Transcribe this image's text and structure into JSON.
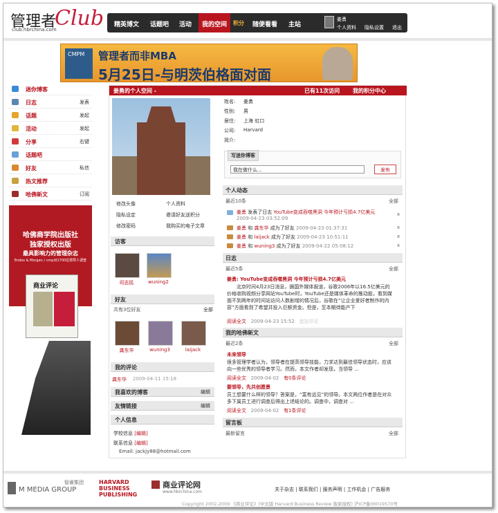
{
  "header": {
    "logo_cn": "管理者",
    "logo_club": "Club",
    "logo_url": "club.hbrchina.com",
    "nav": [
      "精英博文",
      "话题吧",
      "活动",
      "我的空间",
      "积分",
      "随便看看",
      "主站"
    ],
    "user_name": "姜勇",
    "user_links": [
      "个人资料",
      "隐私设置",
      "退出"
    ]
  },
  "banner": {
    "cmpm": "CMPM",
    "line1": "管理者而非MBA",
    "line2": "5月25日-与明茨伯格面对面"
  },
  "sidebar": {
    "items": [
      {
        "label": "迷你博客",
        "action": "",
        "color": "#3a8bd6"
      },
      {
        "label": "日志",
        "action": "发表",
        "color": "#5b86b3"
      },
      {
        "label": "话题",
        "action": "发起",
        "color": "#e5a52d"
      },
      {
        "label": "活动",
        "action": "发起",
        "color": "#e2b53c"
      },
      {
        "label": "分享",
        "action": "右键",
        "color": "#cf3a3a"
      },
      {
        "label": "话题吧",
        "action": "",
        "color": "#6aa0d8"
      },
      {
        "label": "好友",
        "action": "私信",
        "color": "#d88a2f"
      },
      {
        "label": "热文推荐",
        "action": "",
        "color": "#c6a144"
      },
      {
        "label": "哈佛新文",
        "action": "订阅",
        "color": "#9b2d2d"
      }
    ],
    "ad": {
      "l1": "哈佛商学院出版社",
      "l2": "独家授权出版",
      "l3": "最具影响力的管理杂志",
      "l4": "Endos & Morgan / cmp对1700位领导人调查",
      "book": "商业评论"
    }
  },
  "main": {
    "title": "姜勇的个人空间 -",
    "visits": "已有11次访问",
    "points_link": "我的积分中心",
    "actions": [
      "修改头像",
      "个人资料",
      "隐私设定",
      "邀请好友送积分",
      "修改密码",
      "我购买的电子文章"
    ],
    "profile": [
      {
        "k": "姓名:",
        "v": "姜勇"
      },
      {
        "k": "性别:",
        "v": "男"
      },
      {
        "k": "居住:",
        "v": "上海 虹口"
      },
      {
        "k": "公司:",
        "v": "Harvard"
      },
      {
        "k": "简介:",
        "v": ""
      }
    ],
    "post": {
      "tab": "写迷你博客",
      "placeholder": "我在做什么...",
      "button": "发布"
    },
    "visitors": {
      "title": "访客",
      "people": [
        "司志民",
        "wuning2"
      ]
    },
    "friends": {
      "title": "好友",
      "sub": "共有3位好友",
      "all": "全部",
      "people": [
        "龚东华",
        "wuning3",
        "laijack"
      ]
    },
    "comments": {
      "title": "我的评论",
      "item": "龚东华",
      "date": "2009-04-11 15:18"
    },
    "blogs": {
      "title": "我喜欢的博客",
      "edit": "编辑"
    },
    "links": {
      "title": "友情链接",
      "edit": "编辑"
    },
    "pinfo": {
      "title": "个人信息",
      "school": "学校信息",
      "school_edit": "[编辑]",
      "contact": "联系信息",
      "contact_edit": "[编辑]",
      "email": "Email: jackjy88@hotmail.com"
    },
    "activity": {
      "title": "个人动态",
      "sub": "最近10条",
      "all": "全部",
      "items": [
        {
          "u": "姜勇",
          "t": "发表了日志",
          "l": "YouTube变成吞噬黑洞 今年预计亏损4.7亿美元",
          "d": "2009-04-23 03:52:09"
        },
        {
          "u": "姜勇",
          "t": "和",
          "f": "龚东华",
          "e": "成为了好友",
          "d": "2009-04-23 01:37:31"
        },
        {
          "u": "姜勇",
          "t": "和",
          "f": "laijack",
          "e": "成为了好友",
          "d": "2009-04-23 10:51:11"
        },
        {
          "u": "姜勇",
          "t": "和",
          "f": "wuning3",
          "e": "成为了好友",
          "d": "2009-04-22 05:08:12"
        }
      ]
    },
    "journal": {
      "title": "日志",
      "sub": "最近5条",
      "all": "全部",
      "post_title": "姜勇: YouTube变成吞噬黑洞 今年预计亏损4.7亿美元",
      "body": "北京时间4月23日消息，据国外媒体报道，谷歌2006年以16.5亿美元的价格收购视频分享网站YouTube时，YouTube还是媒体革命的推动股，看到媒面不到两年的时间站访问人数剧增的情况后，谷歌在“让企业爱好者制作的内容”方面看到了希望并投入巨额资金。但是，至本期待能产下",
      "read": "阅读全文",
      "date": "2009-04-23 15:52",
      "comment": "追加评论"
    },
    "hbr": {
      "title": "我的哈佛新文",
      "sub": "最近2条",
      "all": "全部",
      "items": [
        {
          "t": "未来领导",
          "b": "很多管理学者认为，领导者在提高领导技能，力求达到最佳领导状态时，应该向一些优秀的领导者学习。然而，本文作者却发现，当领导 ...",
          "read": "阅读全文",
          "d": "2009-04-02",
          "c": "有0条评论"
        },
        {
          "t": "要领导，先共创愿景",
          "b": "员工想要什么样的领导？答案是，“富有远见”的领导。本文两位作者是在对众多下属员工进行调查后得出上述结论的。调查中，调查对 ...",
          "read": "阅读全文",
          "d": "2009-04-02",
          "c": "有1条评论"
        }
      ]
    },
    "board": {
      "title": "留言板",
      "sub": "最新留言",
      "all": "全部"
    }
  },
  "footer": {
    "m": "M MEDIA GROUP",
    "m_cn": "智睿集团",
    "hbp": "HARVARD BUSINESS PUBLISHING",
    "hbr_cn": "商业评论网",
    "hbr_url": "www.hbrchina.com",
    "links": [
      "关于杂志",
      "联系我们",
      "服务声明",
      "工作机会",
      "广告服务"
    ],
    "copy": "Copyright 2002-2009 《商业评论》(中文版 Harvard Business Review 独家授权) 沪ICP备06019570号"
  }
}
